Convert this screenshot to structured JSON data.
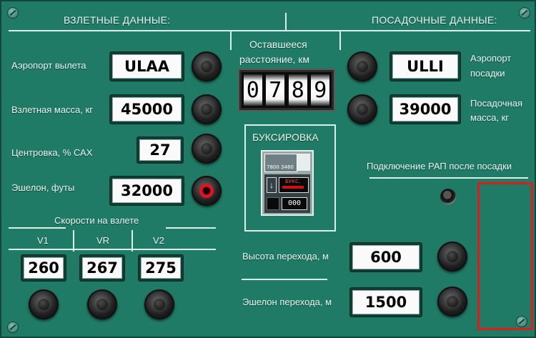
{
  "headers": {
    "takeoff": "ВЗЛЕТНЫЕ ДАННЫЕ:",
    "landing": "ПОСАДОЧНЫЕ ДАННЫЕ:",
    "remaining_line1": "Оставшееся",
    "remaining_line2": "расстояние, км",
    "speeds": "Скорости на взлете"
  },
  "takeoff": {
    "airport_label": "Аэропорт вылета",
    "airport_value": "ULAA",
    "mass_label": "Взлетная масса, кг",
    "mass_value": "45000",
    "cg_label": "Центровка, % САХ",
    "cg_value": "27",
    "fl_label": "Эшелон, футы",
    "fl_value": "32000"
  },
  "speeds": {
    "v1_label": "V1",
    "vr_label": "VR",
    "v2_label": "V2",
    "v1_value": "260",
    "vr_value": "267",
    "v2_value": "275"
  },
  "remaining": {
    "digits": [
      "0",
      "7",
      "8",
      "9"
    ]
  },
  "towing": {
    "title": "БУКСИРОВКА",
    "thumb_text": "7800 3460",
    "mode_label": "БУКС.",
    "counter": "000"
  },
  "landing": {
    "airport_label_1": "Аэропорт",
    "airport_label_2": "посадки",
    "airport_value": "ULLI",
    "mass_label_1": "Посадочная",
    "mass_label_2": "масса, кг",
    "mass_value": "39000",
    "apu_label": "Подключение РАП после посадки",
    "trans_alt_label": "Высота перехода, м",
    "trans_alt_value": "600",
    "trans_fl_label": "Эшелон перехода, м",
    "trans_fl_value": "1500"
  },
  "colors": {
    "panel": "#1f7a66",
    "highlight": "#e01b1b",
    "line": "#d9efe8"
  }
}
